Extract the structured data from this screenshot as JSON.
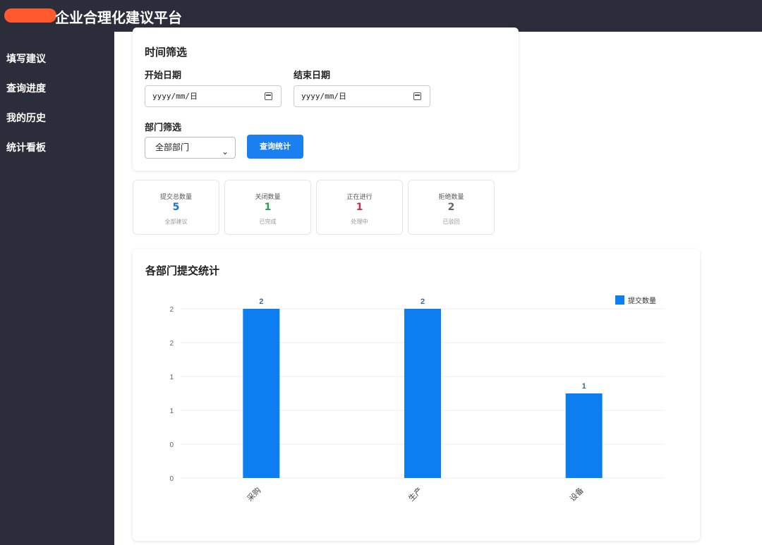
{
  "app": {
    "title": "企业合理化建议平台"
  },
  "sidebar": {
    "items": [
      {
        "label": "填写建议"
      },
      {
        "label": "查询进度"
      },
      {
        "label": "我的历史"
      },
      {
        "label": "统计看板"
      }
    ]
  },
  "filter": {
    "title": "时间筛选",
    "start_label": "开始日期",
    "start_placeholder": "yyyy/mm/日",
    "end_label": "结束日期",
    "end_placeholder": "yyyy/mm/日",
    "dept_label": "部门筛选",
    "dept_selected": "全部部门",
    "query_button": "查询统计"
  },
  "stats": [
    {
      "label": "提交总数量",
      "value": "5",
      "sub": "全部建议",
      "color": "#1a6fd8"
    },
    {
      "label": "关闭数量",
      "value": "1",
      "sub": "已完成",
      "color": "#2e9d4f"
    },
    {
      "label": "正在进行",
      "value": "1",
      "sub": "处理中",
      "color": "#c2334d"
    },
    {
      "label": "拒绝数量",
      "value": "2",
      "sub": "已驳回",
      "color": "#666666"
    }
  ],
  "chart_card": {
    "title": "各部门提交统计"
  },
  "chart_data": {
    "type": "bar",
    "title": "",
    "categories": [
      "采购",
      "生产",
      "设备"
    ],
    "series": [
      {
        "name": "提交数量",
        "values": [
          2,
          2,
          1
        ]
      }
    ],
    "data_labels": [
      "2",
      "2",
      "1"
    ],
    "y_tick_labels": [
      "0",
      "0",
      "1",
      "1",
      "2",
      "2"
    ],
    "ylim": [
      0,
      2
    ],
    "grid": true,
    "legend": "top-right",
    "bar_color": "#0d7ef0"
  }
}
